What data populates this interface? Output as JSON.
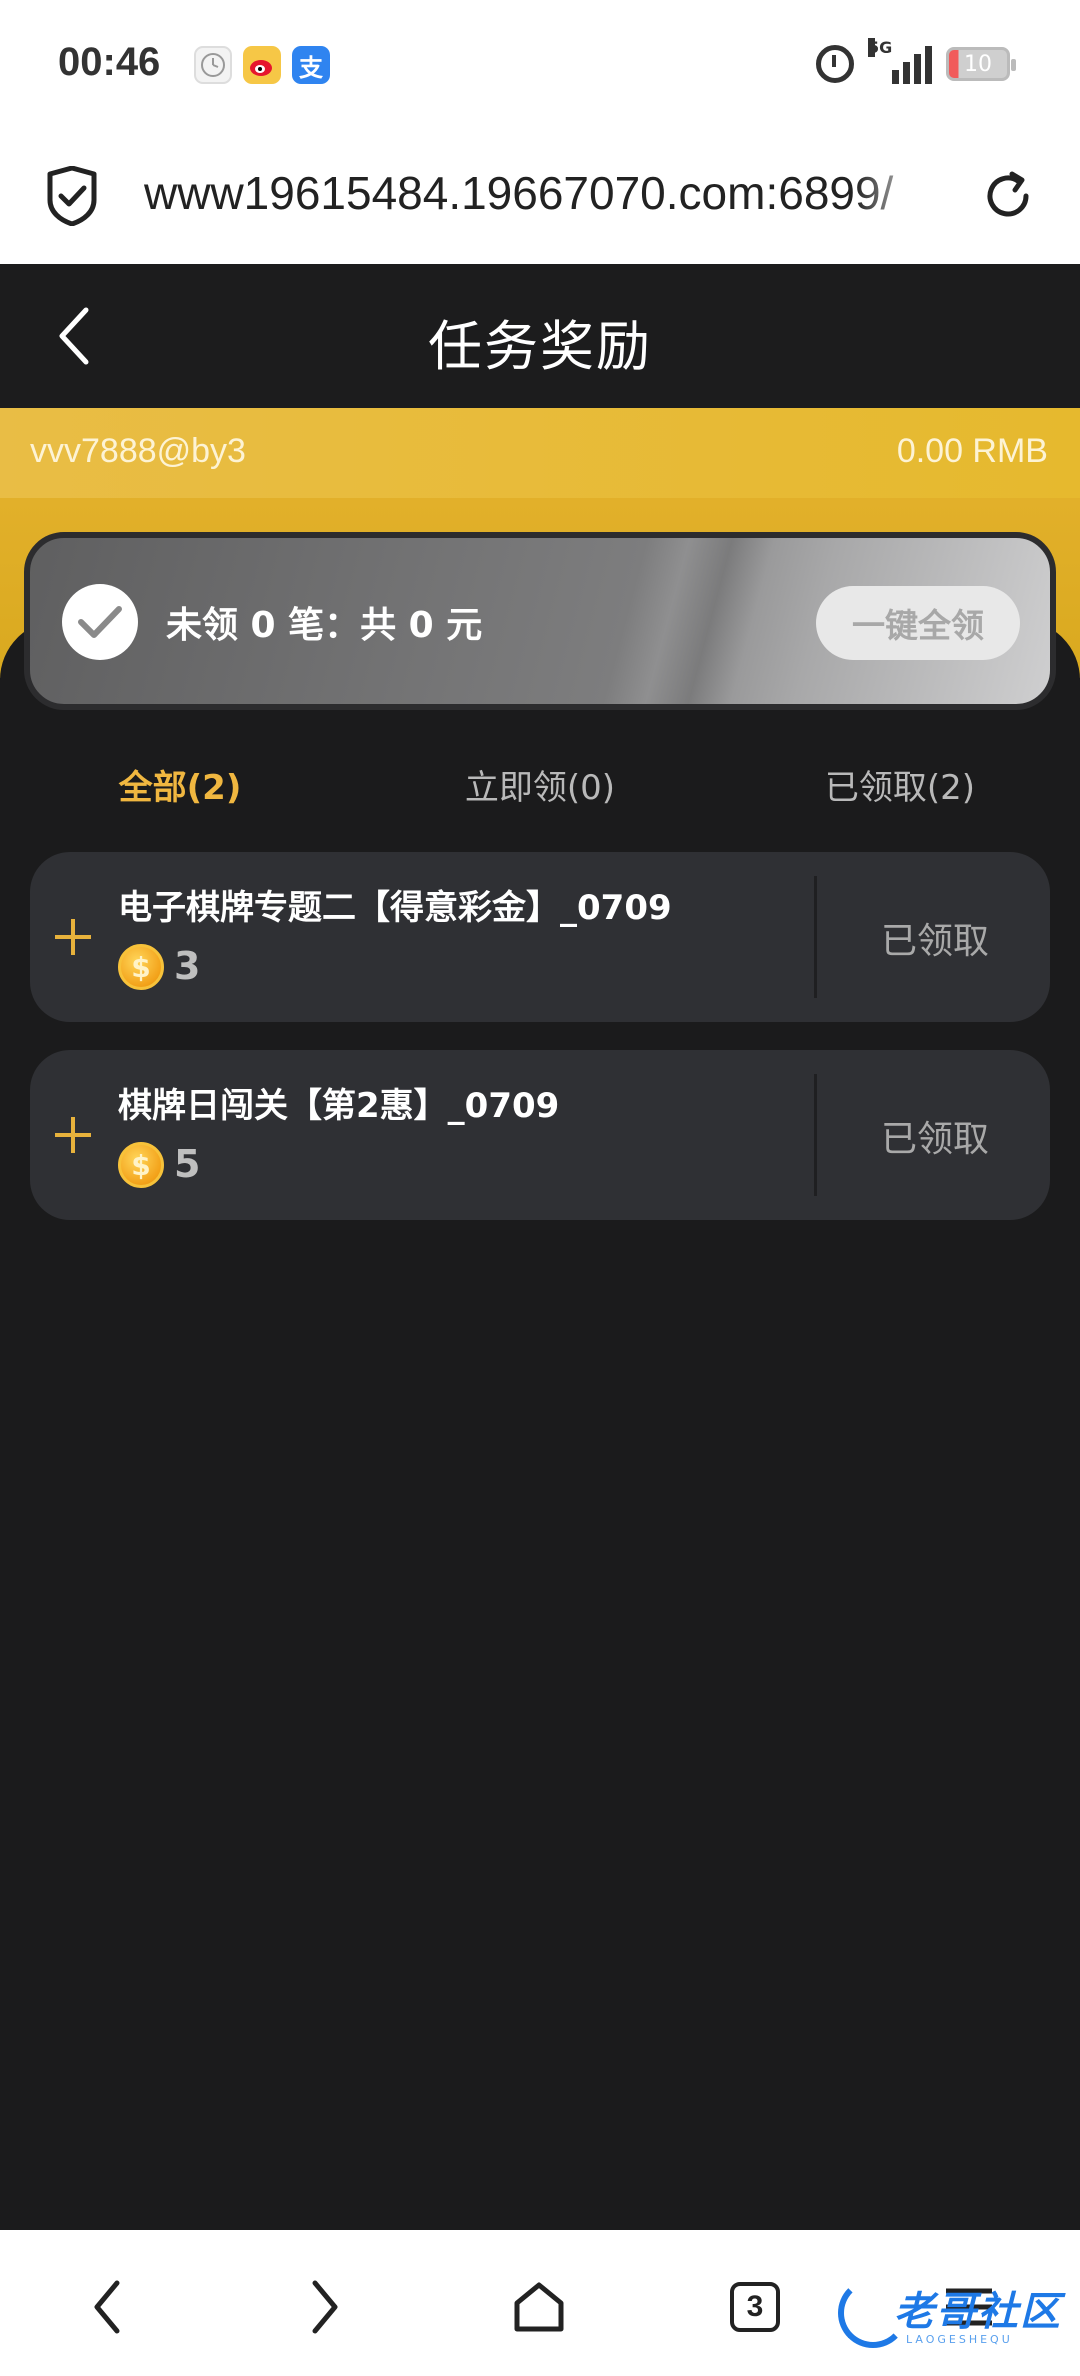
{
  "status_bar": {
    "time": "00:46",
    "network": "5G",
    "battery": "10",
    "icons": [
      "clock-app-icon",
      "weibo-app-icon",
      "alipay-app-icon",
      "alarm-icon",
      "signal-icon",
      "battery-icon"
    ],
    "alipay_glyph": "支"
  },
  "browser": {
    "url": "www19615484.19667070.com:6899/",
    "tab_count": "3"
  },
  "header": {
    "title": "任务奖励"
  },
  "account": {
    "username": "vvv7888@by3",
    "balance": "0.00 RMB"
  },
  "summary": {
    "text": "未领 0 笔：共 0 元",
    "claim_all_label": "一键全领"
  },
  "tabs": [
    {
      "label": "全部(2)",
      "active": true
    },
    {
      "label": "立即领(0)",
      "active": false
    },
    {
      "label": "已领取(2)",
      "active": false
    }
  ],
  "tasks": [
    {
      "title": "电子棋牌专题二【得意彩金】_0709",
      "reward": "3",
      "status": "已领取"
    },
    {
      "title": "棋牌日闯关【第2惠】_0709",
      "reward": "5",
      "status": "已领取"
    }
  ],
  "watermark": {
    "text": "老哥社区",
    "sub": "LAOGESHEQU"
  },
  "colors": {
    "accent_gold": "#f0b740",
    "strip_gold": "#e9bd45",
    "background": "#1b1b1c",
    "card": "#2f3034",
    "watermark_blue": "#1e79e6"
  }
}
